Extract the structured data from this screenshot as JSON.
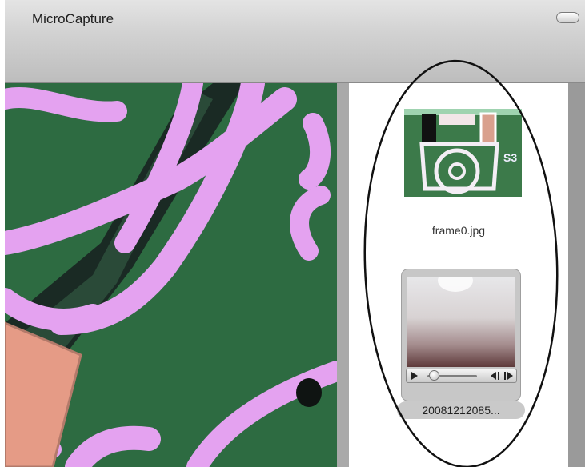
{
  "window": {
    "title": "MicroCapture"
  },
  "sidebar": {
    "items": [
      {
        "label": "frame0.jpg",
        "kind": "photo",
        "icon": "image-thumbnail-icon"
      },
      {
        "label": "20081212085...",
        "kind": "movie",
        "icon": "movie-thumbnail-icon"
      }
    ]
  },
  "colors": {
    "pcb_green": "#2d6b41",
    "trace_pink": "#e4a2f0",
    "pad_salmon": "#e59b86",
    "annotation": "#111111"
  }
}
